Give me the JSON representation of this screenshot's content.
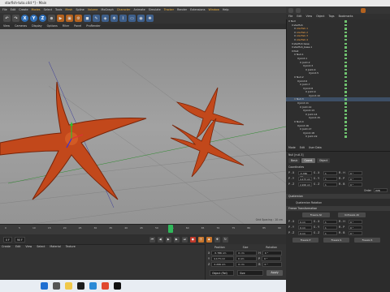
{
  "window": {
    "title": "starfish-tuto.c4d *] - Main"
  },
  "menubar": {
    "items": [
      "File",
      "Edit",
      "Create",
      "Modes",
      "Select",
      "Tools",
      "Mesh",
      "Spline",
      "Volume",
      "MoGraph",
      "Character",
      "Animate",
      "Simulate",
      "Tracker",
      "Render",
      "Extensions",
      "Window",
      "Help"
    ],
    "highlighted": [
      "Modes",
      "Mesh",
      "Volume",
      "Character",
      "Tracker",
      "Window"
    ]
  },
  "toolbar": {
    "axis_labels": [
      "X",
      "Y",
      "Z"
    ]
  },
  "viewport": {
    "menu": [
      "View",
      "Cameras",
      "Display",
      "Options",
      "Filter",
      "Panel",
      "ProRender"
    ],
    "hud": "Grid Spacing : 10 cm"
  },
  "timeline": {
    "frames": [
      "0",
      "5",
      "10",
      "15",
      "20",
      "25",
      "30",
      "35",
      "40",
      "45",
      "50",
      "55",
      "60",
      "65",
      "70",
      "75",
      "80",
      "85",
      "90"
    ],
    "current_frame": "0 F",
    "end_frame": "90 F"
  },
  "materials": {
    "menu": [
      "Create",
      "Edit",
      "View",
      "Select",
      "Material",
      "Texture"
    ]
  },
  "coordinates": {
    "headers": [
      "Position",
      "Size",
      "Rotation"
    ],
    "rows": [
      {
        "axis": "X",
        "pos": "-5.786 cm",
        "size": "0 cm",
        "rot_axis": "H",
        "rot": "0 °"
      },
      {
        "axis": "Y",
        "pos": "4.173 cm",
        "size": "0 cm",
        "rot_axis": "P",
        "rot": "0 °"
      },
      {
        "axis": "Z",
        "pos": "2.206 cm",
        "size": "0 cm",
        "rot_axis": "B",
        "rot": "0 °"
      }
    ],
    "mode": "Object (Rel)",
    "size_mode": "Size",
    "apply": "Apply"
  },
  "object_manager": {
    "menu": [
      "File",
      "Edit",
      "View",
      "Object",
      "Tags",
      "Bookmarks"
    ],
    "items": [
      {
        "label": "Null",
        "indent": 0,
        "style": "normal"
      },
      {
        "label": "starfish",
        "indent": 1,
        "style": "normal"
      },
      {
        "label": "starfish.1",
        "indent": 2,
        "style": "orange"
      },
      {
        "label": "starfish.2",
        "indent": 2,
        "style": "orange"
      },
      {
        "label": "starfish.3",
        "indent": 2,
        "style": "orange"
      },
      {
        "label": "starfish.4",
        "indent": 2,
        "style": "orange"
      },
      {
        "label": "starfish base",
        "indent": 1,
        "style": "normal"
      },
      {
        "label": "starfish_base.1",
        "indent": 1,
        "style": "normal"
      },
      {
        "label": "Null",
        "indent": 1,
        "style": "normal"
      },
      {
        "label": "Null.1",
        "indent": 2,
        "style": "normal"
      },
      {
        "label": "Joint.1",
        "indent": 3,
        "style": "normal"
      },
      {
        "label": "Joint.2",
        "indent": 4,
        "style": "normal"
      },
      {
        "label": "Joint.3",
        "indent": 5,
        "style": "normal"
      },
      {
        "label": "Joint.4",
        "indent": 6,
        "style": "normal"
      },
      {
        "label": "Joint.5",
        "indent": 7,
        "style": "normal"
      },
      {
        "label": "Null.2",
        "indent": 2,
        "style": "normal"
      },
      {
        "label": "Joint.6",
        "indent": 3,
        "style": "normal"
      },
      {
        "label": "Joint.7",
        "indent": 4,
        "style": "normal"
      },
      {
        "label": "Joint.8",
        "indent": 5,
        "style": "normal"
      },
      {
        "label": "Joint.9",
        "indent": 6,
        "style": "normal"
      },
      {
        "label": "Joint.10",
        "indent": 7,
        "style": "normal"
      },
      {
        "label": "Null.3",
        "indent": 2,
        "style": "sel"
      },
      {
        "label": "Joint.11",
        "indent": 3,
        "style": "normal"
      },
      {
        "label": "Joint.12",
        "indent": 4,
        "style": "normal"
      },
      {
        "label": "Joint.13",
        "indent": 5,
        "style": "normal"
      },
      {
        "label": "Joint.14",
        "indent": 6,
        "style": "normal"
      },
      {
        "label": "Joint.15",
        "indent": 7,
        "style": "normal"
      },
      {
        "label": "Null.4",
        "indent": 2,
        "style": "normal"
      },
      {
        "label": "Joint.16",
        "indent": 3,
        "style": "normal"
      },
      {
        "label": "Joint.17",
        "indent": 4,
        "style": "normal"
      },
      {
        "label": "Joint.18",
        "indent": 5,
        "style": "normal"
      },
      {
        "label": "Joint.19",
        "indent": 6,
        "style": "normal"
      }
    ]
  },
  "attributes": {
    "menu": [
      "Mode",
      "Edit",
      "User Data"
    ],
    "object_title": "Null [null.3]",
    "tabs": [
      "Basic",
      "Coord.",
      "Object"
    ],
    "section_coordinates": "Coordinates",
    "rows": [
      {
        "p": "P . X",
        "pv": "-5.786 cm",
        "s": "S . X",
        "sv": "1",
        "r": "R . H",
        "rv": "0 °"
      },
      {
        "p": "P . Y",
        "pv": "4.173 cm",
        "s": "S . Y",
        "sv": "1",
        "r": "R . P",
        "rv": "0 °"
      },
      {
        "p": "P . Z",
        "pv": "2.206 cm",
        "s": "S . Z",
        "sv": "1",
        "r": "R . B",
        "rv": "0 °"
      }
    ],
    "order_label": "Order",
    "order_value": "HPB",
    "section_quat": "Quaternion",
    "quat_label": "Quaternion Rotation",
    "section_freeze": "Freeze Transformation",
    "freeze_all": "Freeze All",
    "unfreeze_all": "Unfreeze All",
    "freeze_rows": [
      {
        "p": "P . X",
        "pv": "0 cm",
        "s": "S . X",
        "sv": "1",
        "r": "R . H",
        "rv": "0 °"
      },
      {
        "p": "P . Y",
        "pv": "0 cm",
        "s": "S . Y",
        "sv": "1",
        "r": "R . P",
        "rv": "0 °"
      },
      {
        "p": "P . Z",
        "pv": "0 cm",
        "s": "S . Z",
        "sv": "1",
        "r": "R . B",
        "rv": "0 °"
      }
    ],
    "freeze_p": "Freeze P",
    "freeze_s": "Freeze S",
    "freeze_r": "Freeze R"
  },
  "colors": {
    "starfish": "#c2481b",
    "starfish_dark": "#7a2408",
    "accent": "#f7b53b",
    "select": "#3d4f66"
  }
}
